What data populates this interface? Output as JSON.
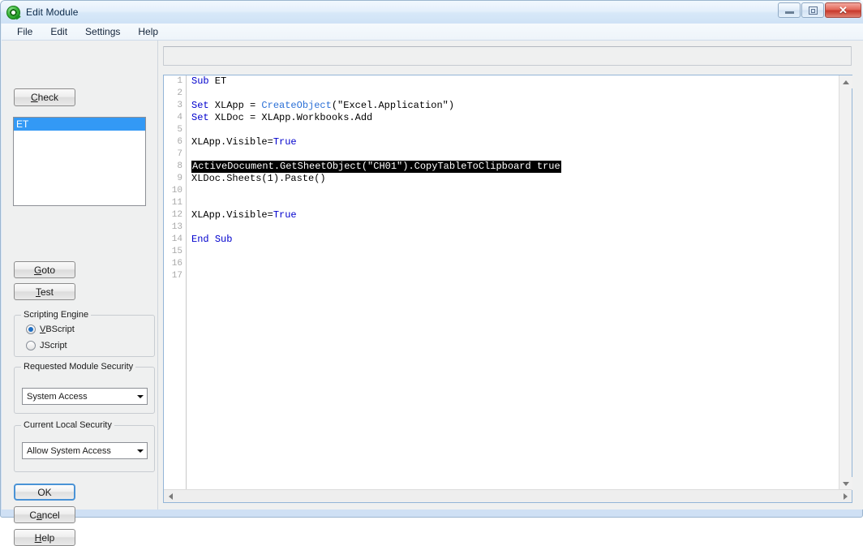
{
  "window": {
    "title": "Edit Module",
    "icon": "qlikview-logo-icon",
    "controls": {
      "minimize": "–",
      "restore": "□",
      "close": "✕"
    }
  },
  "menubar": {
    "items": [
      {
        "label": "File"
      },
      {
        "label": "Edit"
      },
      {
        "label": "Settings"
      },
      {
        "label": "Help"
      }
    ]
  },
  "sidebar": {
    "check_button": "Check",
    "module_list": {
      "items": [
        {
          "label": "ET",
          "selected": true
        }
      ]
    },
    "goto_button": "Goto",
    "test_button": "Test",
    "scripting_engine": {
      "title": "Scripting Engine",
      "options": [
        {
          "label": "VBScript",
          "checked": true
        },
        {
          "label": "JScript",
          "checked": false
        }
      ]
    },
    "requested_module_security": {
      "title": "Requested Module Security",
      "value": "System Access"
    },
    "current_local_security": {
      "title": "Current Local Security",
      "value": "Allow System Access"
    },
    "ok_button": "OK",
    "cancel_button": "Cancel",
    "help_button": "Help"
  },
  "editor": {
    "top_field_value": "",
    "gutter": [
      "1",
      "2",
      "3",
      "4",
      "5",
      "6",
      "7",
      "8",
      "9",
      "10",
      "11",
      "12",
      "13",
      "14",
      "15",
      "16",
      "17"
    ],
    "lines": [
      {
        "n": 1,
        "segments": [
          {
            "t": "Sub",
            "c": "kw"
          },
          {
            "t": " ET",
            "c": ""
          }
        ]
      },
      {
        "n": 2,
        "segments": [
          {
            "t": "",
            "c": ""
          }
        ]
      },
      {
        "n": 3,
        "segments": [
          {
            "t": "Set",
            "c": "kw"
          },
          {
            "t": " XLApp = ",
            "c": ""
          },
          {
            "t": "CreateObject",
            "c": "fn"
          },
          {
            "t": "(\"Excel.Application\")",
            "c": ""
          }
        ]
      },
      {
        "n": 4,
        "segments": [
          {
            "t": "Set",
            "c": "kw"
          },
          {
            "t": " XLDoc = XLApp.Workbooks.Add",
            "c": ""
          }
        ]
      },
      {
        "n": 5,
        "segments": [
          {
            "t": "",
            "c": ""
          }
        ]
      },
      {
        "n": 6,
        "segments": [
          {
            "t": "XLApp.Visible=",
            "c": ""
          },
          {
            "t": "True",
            "c": "kw"
          }
        ]
      },
      {
        "n": 7,
        "segments": [
          {
            "t": "",
            "c": ""
          }
        ]
      },
      {
        "n": 8,
        "segments": [
          {
            "t": "ActiveDocument.GetSheetObject(\"CH01\").CopyTableToClipboard true",
            "c": "sel"
          }
        ]
      },
      {
        "n": 9,
        "segments": [
          {
            "t": "XLDoc.Sheets(1).Paste()",
            "c": ""
          }
        ]
      },
      {
        "n": 10,
        "segments": [
          {
            "t": "",
            "c": ""
          }
        ]
      },
      {
        "n": 11,
        "segments": [
          {
            "t": "",
            "c": ""
          }
        ]
      },
      {
        "n": 12,
        "segments": [
          {
            "t": "XLApp.Visible=",
            "c": ""
          },
          {
            "t": "True",
            "c": "kw"
          }
        ]
      },
      {
        "n": 13,
        "segments": [
          {
            "t": "",
            "c": ""
          }
        ]
      },
      {
        "n": 14,
        "segments": [
          {
            "t": "End",
            "c": "kw"
          },
          {
            "t": " ",
            "c": ""
          },
          {
            "t": "Sub",
            "c": "kw"
          }
        ]
      },
      {
        "n": 15,
        "segments": [
          {
            "t": "",
            "c": ""
          }
        ]
      },
      {
        "n": 16,
        "segments": [
          {
            "t": "",
            "c": ""
          }
        ]
      },
      {
        "n": 17,
        "segments": [
          {
            "t": "",
            "c": ""
          }
        ]
      }
    ]
  },
  "colors": {
    "selection_blue": "#3399f5",
    "keyword_blue": "#0000cd",
    "function_blue": "#2a6fd6",
    "highlight_bg": "#000000",
    "highlight_fg": "#ffffff",
    "close_button_red": "#c8392c"
  }
}
